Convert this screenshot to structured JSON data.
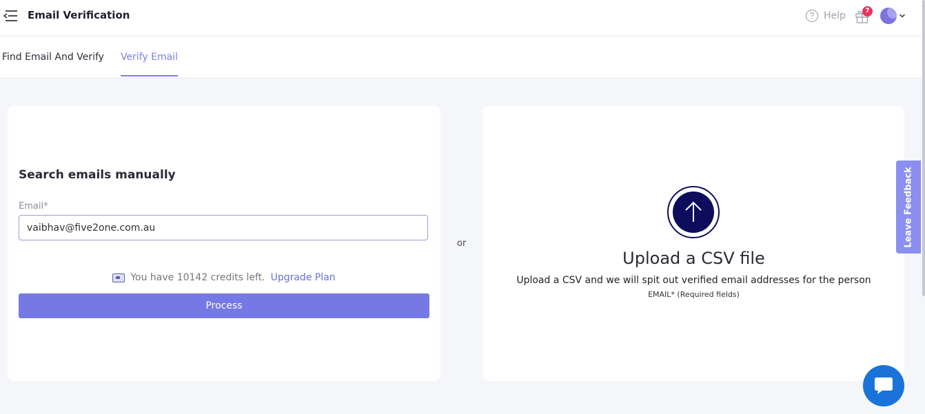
{
  "header": {
    "title": "Email Verification",
    "help_label": "Help",
    "notification_count": "7"
  },
  "tabs": [
    {
      "label": "Find Email And Verify",
      "active": false
    },
    {
      "label": "Verify Email",
      "active": true
    }
  ],
  "manual_search": {
    "title": "Search emails manually",
    "email_label": "Email*",
    "email_value": "vaibhav@five2one.com.au",
    "credits_text": "You have 10142 credits left.",
    "upgrade_label": "Upgrade Plan",
    "process_label": "Process"
  },
  "separator_text": "or",
  "upload": {
    "title": "Upload a CSV file",
    "description": "Upload a CSV and we will spit out verified email addresses for the person",
    "note": "EMAIL* (Required fields)"
  },
  "feedback_label": "Leave Feedback",
  "icons": {
    "menu": "menu-collapse-icon",
    "help": "question-circle-icon",
    "gift": "gift-icon",
    "avatar": "user-avatar",
    "chevron": "chevron-down-icon",
    "credits": "credit-card-icon",
    "upload": "arrow-up-icon",
    "chat": "chat-bubble-icon"
  },
  "colors": {
    "accent": "#7479e6",
    "link": "#6a6fd8",
    "upload_circle": "#0d0d5c",
    "badge": "#e8335b",
    "feedback_tab": "#8a8ff0",
    "chat": "#1a73d8"
  }
}
